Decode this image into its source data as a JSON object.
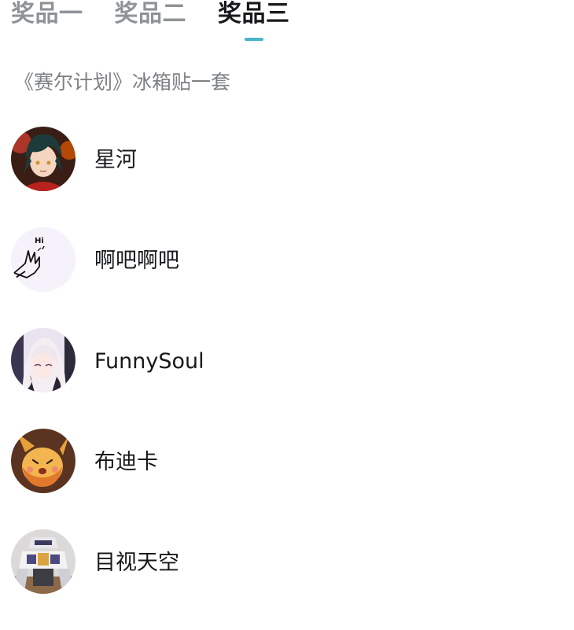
{
  "tabs": [
    {
      "label": "奖品一",
      "active": false
    },
    {
      "label": "奖品二",
      "active": false
    },
    {
      "label": "奖品三",
      "active": true
    }
  ],
  "prize": {
    "description": "《赛尔计划》冰箱贴一套"
  },
  "winners": [
    {
      "name": "星河",
      "avatar": "anime-character-avatar"
    },
    {
      "name": "啊吧啊吧",
      "avatar": "waving-hand-avatar"
    },
    {
      "name": "FunnySoul",
      "avatar": "anime-girl-avatar"
    },
    {
      "name": "布迪卡",
      "avatar": "cartoon-creature-avatar"
    },
    {
      "name": "目视天空",
      "avatar": "mecha-robot-avatar"
    }
  ],
  "colors": {
    "active_tab_text": "#18191c",
    "inactive_tab_text": "#8f9397",
    "indicator": "#4bb4cc",
    "description_text": "#7d8084",
    "name_text": "#18191c"
  }
}
